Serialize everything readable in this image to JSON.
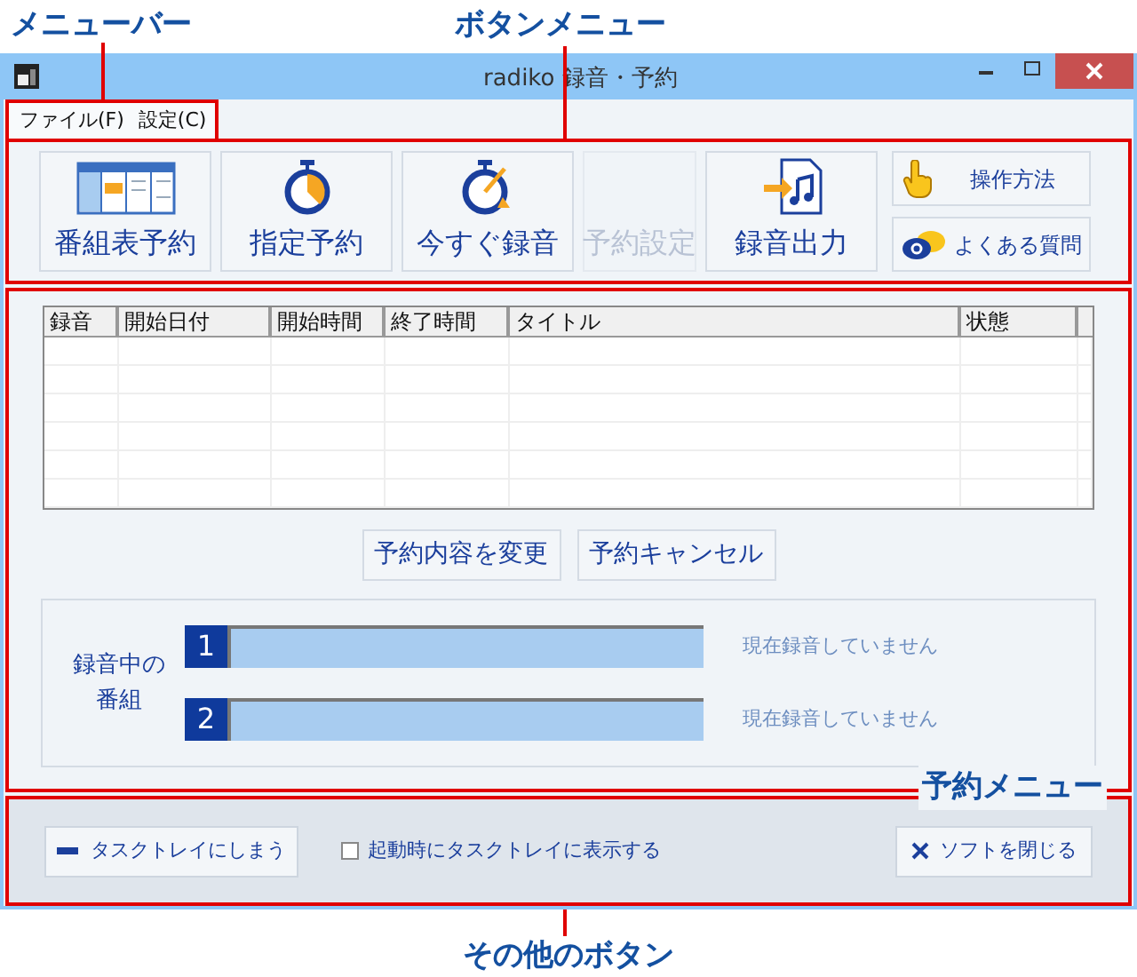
{
  "callouts": [
    "メニューバー",
    "ボタンメニュー",
    "予約メニュー",
    "その他のボタン"
  ],
  "window": {
    "title": "radiko 録音・予約"
  },
  "menu": [
    "ファイル(F)",
    "設定(C)"
  ],
  "toolbar": [
    {
      "label": "番組表予約",
      "kind": "timetable",
      "disabled": false
    },
    {
      "label": "指定予約",
      "kind": "timer",
      "disabled": false
    },
    {
      "label": "今すぐ録音",
      "kind": "record",
      "disabled": false
    },
    {
      "label": "予約設定",
      "kind": "plain",
      "disabled": true
    },
    {
      "label": "録音出力",
      "kind": "export",
      "disabled": false
    }
  ],
  "help_buttons": [
    {
      "label": "操作方法",
      "kind": "hand"
    },
    {
      "label": "よくある質問",
      "kind": "faq"
    }
  ],
  "table": {
    "columns": [
      "録音",
      "開始日付",
      "開始時間",
      "終了時間",
      "タイトル",
      "状態"
    ]
  },
  "actions": [
    "予約内容を変更",
    "予約キャンセル"
  ],
  "recording": {
    "label": "録音中の番組",
    "slots": [
      {
        "number": "1",
        "status": "現在録音していません"
      },
      {
        "number": "2",
        "status": "現在録音していません"
      }
    ]
  },
  "footer": {
    "tray_button": "タスクトレイにしまう",
    "checkbox": {
      "label": "起動時にタスクトレイに表示する",
      "checked": false
    },
    "close_button": "ソフトを閉じる"
  }
}
